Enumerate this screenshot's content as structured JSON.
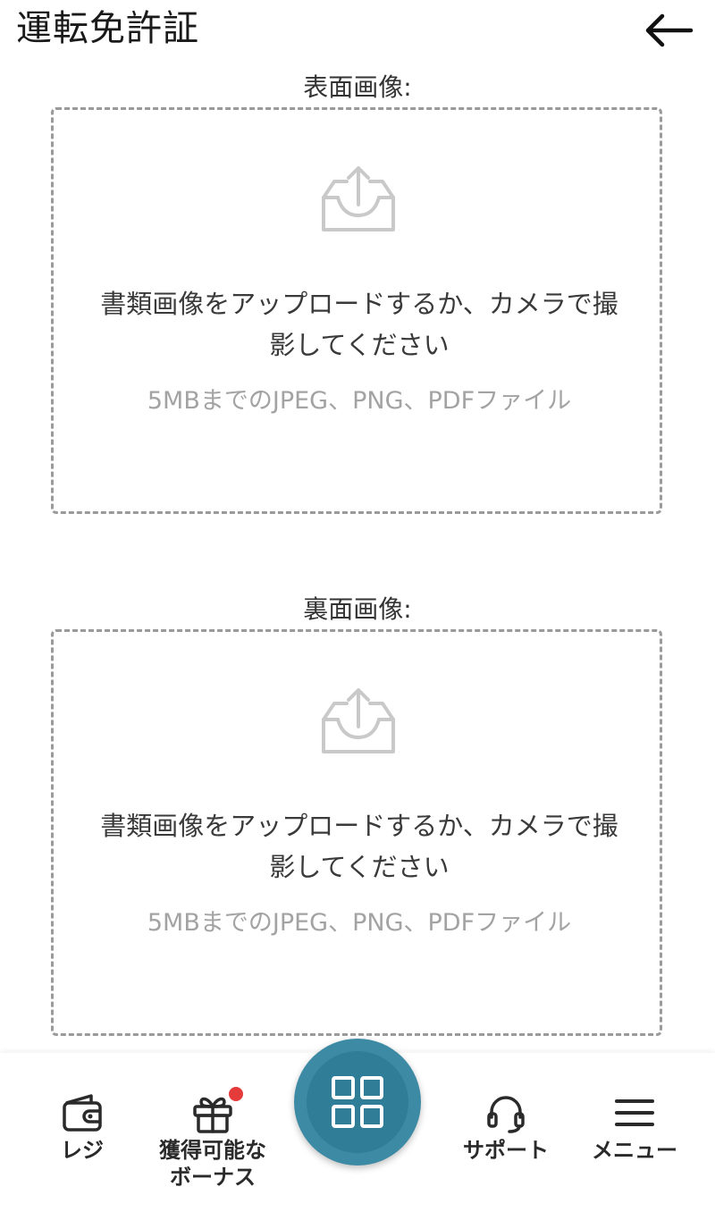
{
  "header": {
    "title": "運転免許証",
    "back_icon": "arrow-left-icon"
  },
  "front": {
    "label": "表面画像:",
    "icon": "upload-tray-icon",
    "main_text": "書類画像をアップロードするか、カメラで撮影してください",
    "sub_text": "5MBまでのJPEG、PNG、PDFファイル"
  },
  "back": {
    "label": "裏面画像:",
    "icon": "upload-tray-icon",
    "main_text": "書類画像をアップロードするか、カメラで撮影してください",
    "sub_text": "5MBまでのJPEG、PNG、PDFファイル"
  },
  "bottom_nav": {
    "items": [
      {
        "label": "レジ",
        "icon": "wallet-icon"
      },
      {
        "label": "獲得可能なボーナス",
        "icon": "gift-icon",
        "badge": true
      },
      {
        "label": "",
        "icon": "grid-icon"
      },
      {
        "label": "サポート",
        "icon": "headset-icon"
      },
      {
        "label": "メニュー",
        "icon": "hamburger-menu-icon"
      }
    ]
  },
  "colors": {
    "accent": "#3d8aa4",
    "badge": "#e53b3b",
    "muted_text": "#a3a3a3",
    "dashed_border": "#9a9a9a"
  }
}
